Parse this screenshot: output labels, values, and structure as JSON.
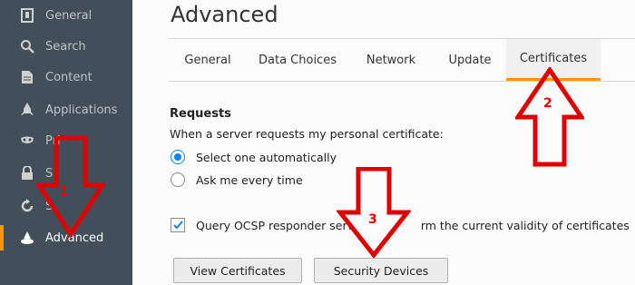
{
  "sidebar": {
    "items": [
      {
        "label": "General",
        "icon": "general-icon"
      },
      {
        "label": "Search",
        "icon": "search-icon"
      },
      {
        "label": "Content",
        "icon": "content-icon"
      },
      {
        "label": "Applications",
        "icon": "applications-icon"
      },
      {
        "label": "Pri",
        "icon": "privacy-icon"
      },
      {
        "label": "S",
        "icon": "security-icon"
      },
      {
        "label": "S",
        "icon": "sync-icon"
      },
      {
        "label": "Advanced",
        "icon": "advanced-icon",
        "active": true
      }
    ]
  },
  "main": {
    "title": "Advanced",
    "tabs": [
      {
        "label": "General"
      },
      {
        "label": "Data Choices"
      },
      {
        "label": "Network"
      },
      {
        "label": "Update"
      },
      {
        "label": "Certificates",
        "active": true
      }
    ],
    "requests": {
      "heading": "Requests",
      "description": "When a server requests my personal certificate:",
      "options": [
        {
          "label": "Select one automatically",
          "checked": true
        },
        {
          "label": "Ask me every time",
          "checked": false
        }
      ]
    },
    "ocsp": {
      "label_left": "Query OCSP responder server",
      "label_right": "rm the current validity of certificates",
      "checked": true
    },
    "buttons": {
      "view_certificates": "View Certificates",
      "security_devices": "Security Devices"
    }
  },
  "annotations": {
    "arrow1": "1",
    "arrow2": "2",
    "arrow3": "3",
    "color": "#e00000"
  },
  "colors": {
    "sidebar_bg": "#424f5a",
    "accent": "#ff9500",
    "radio_blue": "#0a84ff"
  }
}
